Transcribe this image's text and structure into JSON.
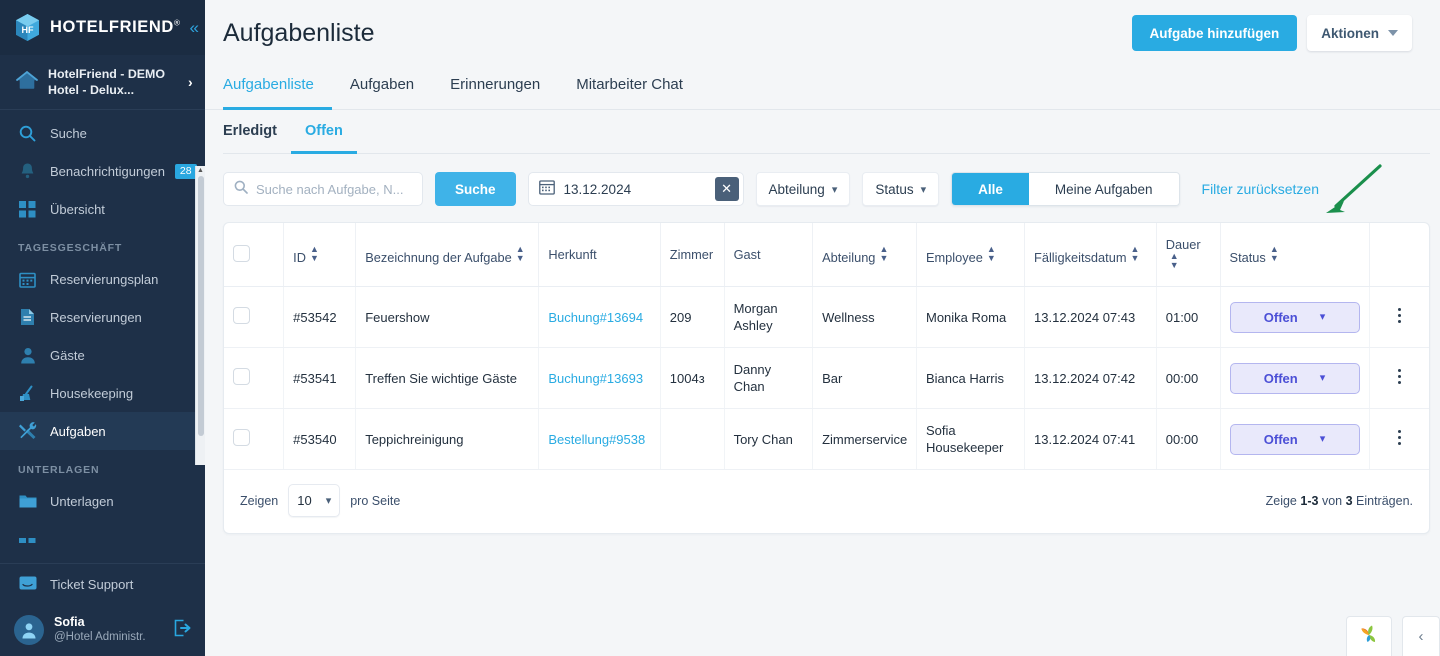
{
  "sidebar": {
    "brand": {
      "name": "HOTELFRIEND",
      "reg": "®",
      "logo_icon": "cube-logo-icon",
      "collapse_icon": "chevron-double-left-icon"
    },
    "hotel_selector": {
      "label": "HotelFriend - DEMO Hotel - Delux...",
      "icon": "home-icon",
      "chevron": "›"
    },
    "items": [
      {
        "label": "Suche",
        "icon": "search-icon",
        "active": false,
        "badge": ""
      },
      {
        "label": "Benachrichtigungen",
        "icon": "bell-icon",
        "active": false,
        "badge": "28"
      },
      {
        "label": "Übersicht",
        "icon": "grid-icon",
        "active": false,
        "badge": ""
      }
    ],
    "section_tagesgeschaeft": "TAGESGESCHÄFT",
    "items_tagesgeschaeft": [
      {
        "label": "Reservierungsplan",
        "icon": "calendar-icon",
        "active": false
      },
      {
        "label": "Reservierungen",
        "icon": "document-icon",
        "active": false
      },
      {
        "label": "Gäste",
        "icon": "user-icon",
        "active": false
      },
      {
        "label": "Housekeeping",
        "icon": "broom-icon",
        "active": false
      },
      {
        "label": "Aufgaben",
        "icon": "tools-icon",
        "active": true
      }
    ],
    "section_unterlagen": "UNTERLAGEN",
    "items_unterlagen": [
      {
        "label": "Unterlagen",
        "icon": "folder-icon",
        "active": false
      }
    ],
    "support": {
      "label": "Ticket Support",
      "icon": "chat-icon"
    },
    "user": {
      "name": "Sofia",
      "role": "@Hotel Administr.",
      "avatar_icon": "avatar-icon",
      "logout_icon": "logout-icon"
    }
  },
  "header": {
    "title": "Aufgabenliste",
    "add_button": "Aufgabe hinzufügen",
    "actions_button": "Aktionen"
  },
  "tabs": [
    {
      "label": "Aufgabenliste",
      "active": true
    },
    {
      "label": "Aufgaben",
      "active": false
    },
    {
      "label": "Erinnerungen",
      "active": false
    },
    {
      "label": "Mitarbeiter Chat",
      "active": false
    }
  ],
  "subtabs": [
    {
      "label": "Erledigt",
      "active": false
    },
    {
      "label": "Offen",
      "active": true
    }
  ],
  "filters": {
    "search_placeholder": "Suche nach Aufgabe, N...",
    "search_value": "",
    "search_icon": "search-icon",
    "search_button": "Suche",
    "date_value": "13.12.2024",
    "date_icon": "calendar-icon",
    "date_clear_icon": "close-icon",
    "department_label": "Abteilung",
    "status_label": "Status",
    "segment": [
      {
        "label": "Alle",
        "active": true
      },
      {
        "label": "Meine Aufgaben",
        "active": false
      }
    ],
    "reset_link": "Filter zurücksetzen"
  },
  "table": {
    "columns": [
      {
        "label": "",
        "sortable": false,
        "key": "checkbox"
      },
      {
        "label": "ID",
        "sortable": true
      },
      {
        "label": "Bezeichnung der Aufgabe",
        "sortable": true
      },
      {
        "label": "Herkunft",
        "sortable": false
      },
      {
        "label": "Zimmer",
        "sortable": false
      },
      {
        "label": "Gast",
        "sortable": false
      },
      {
        "label": "Abteilung",
        "sortable": true
      },
      {
        "label": "Employee",
        "sortable": true
      },
      {
        "label": "Fälligkeitsdatum",
        "sortable": true
      },
      {
        "label": "Dauer",
        "sortable": true
      },
      {
        "label": "Status",
        "sortable": true
      },
      {
        "label": "",
        "sortable": false,
        "key": "actions"
      }
    ],
    "rows": [
      {
        "id": "#53542",
        "title": "Feuershow",
        "origin": "Buchung#13694",
        "room": "209",
        "guest": "Morgan Ashley",
        "department": "Wellness",
        "employee": "Monika Roma",
        "due": "13.12.2024 07:43",
        "duration": "01:00",
        "status": "Offen"
      },
      {
        "id": "#53541",
        "title": "Treffen Sie wichtige Gäste",
        "origin": "Buchung#13693",
        "room": "1004з",
        "guest": "Danny Chan",
        "department": "Bar",
        "employee": "Bianca Harris",
        "due": "13.12.2024 07:42",
        "duration": "00:00",
        "status": "Offen"
      },
      {
        "id": "#53540",
        "title": "Teppichreinigung",
        "origin": "Bestellung#9538",
        "room": "",
        "guest": "Tory Chan",
        "department": "Zimmerservice",
        "employee": "Sofia Housekeeper",
        "due": "13.12.2024 07:41",
        "duration": "00:00",
        "status": "Offen"
      }
    ]
  },
  "footer": {
    "show_label": "Zeigen",
    "per_page_value": "10",
    "per_page_label": "pro Seite",
    "count_prefix": "Zeige",
    "count_range": "1-3",
    "count_middle": "von",
    "count_total": "3",
    "count_suffix": "Einträgen."
  },
  "annotation": {
    "arrow_color": "#1a8f4c",
    "points_to": "Meine Aufgaben"
  },
  "widget": {
    "icon": "leaf-flower-icon",
    "expand_icon": "chevron-left-icon"
  },
  "colors": {
    "accent": "#29abe2",
    "sidebar_bg": "#1e3048",
    "sidebar_active": "#233a55",
    "status_text": "#4b4fd6",
    "status_bg": "#e9e9fb",
    "page_bg": "#f4f6f8"
  }
}
